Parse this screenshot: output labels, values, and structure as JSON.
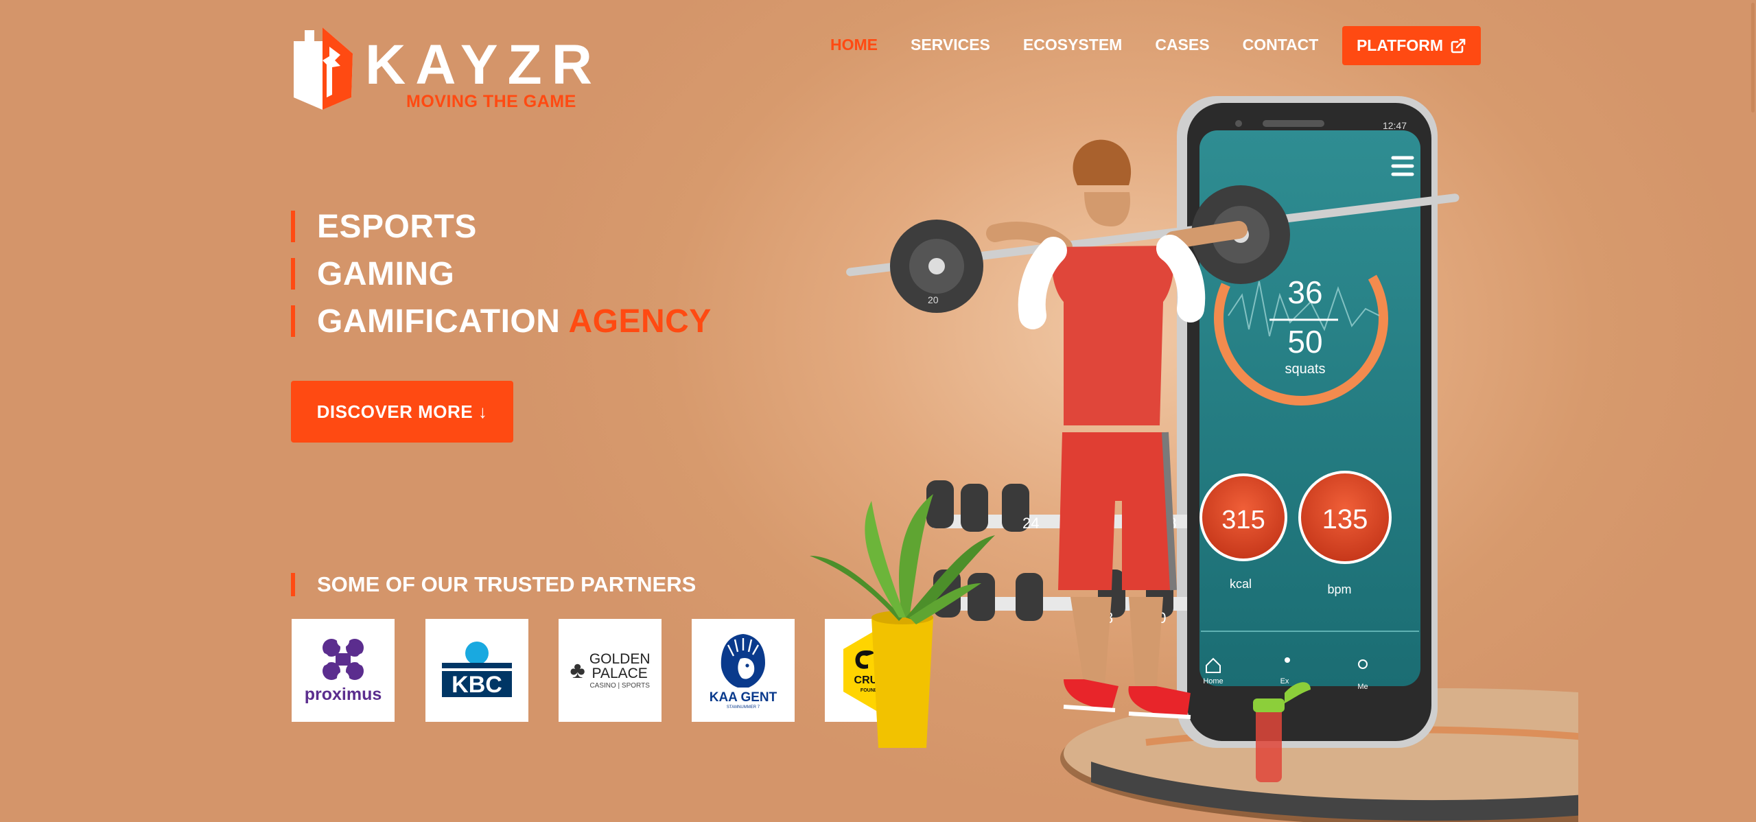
{
  "brand": {
    "name": "KAYZR",
    "tagline": "MOVING THE GAME",
    "colors": {
      "accent": "#ff4a12",
      "background": "#d9a074",
      "text": "#ffffff"
    }
  },
  "nav": {
    "items": [
      {
        "label": "HOME",
        "active": true
      },
      {
        "label": "SERVICES",
        "active": false
      },
      {
        "label": "ECOSYSTEM",
        "active": false
      },
      {
        "label": "CASES",
        "active": false
      },
      {
        "label": "CONTACT",
        "active": false
      }
    ],
    "platform_label": "PLATFORM",
    "platform_icon": "external-link-icon"
  },
  "hero": {
    "lines": [
      {
        "text": "ESPORTS",
        "accent": ""
      },
      {
        "text": "GAMING",
        "accent": ""
      },
      {
        "text": "GAMIFICATION ",
        "accent": "AGENCY"
      }
    ],
    "cta_label": "DISCOVER MORE ↓"
  },
  "partners": {
    "heading": "SOME OF OUR TRUSTED PARTNERS",
    "items": [
      {
        "name": "proximus"
      },
      {
        "name": "KBC"
      },
      {
        "name": "GOLDEN",
        "line2": "PALACE",
        "line3": "CASINO | SPORTS"
      },
      {
        "name": "KAA GENT",
        "line2": "STAMNUMMER 7"
      },
      {
        "name": "CRUYFF",
        "line2": "FOUNDATION"
      }
    ]
  },
  "hero_art": {
    "phone_time": "12:47",
    "squats_done": "36",
    "squats_total": "50",
    "squats_label": "squats",
    "kcal_value": "315",
    "kcal_label": "kcal",
    "bpm_value": "135",
    "bpm_label": "bpm",
    "tab_home": "Home",
    "tab_ex": "Ex",
    "tab_me": "Me",
    "weight_labels": [
      "20",
      "24",
      "28",
      "8",
      "10"
    ]
  }
}
